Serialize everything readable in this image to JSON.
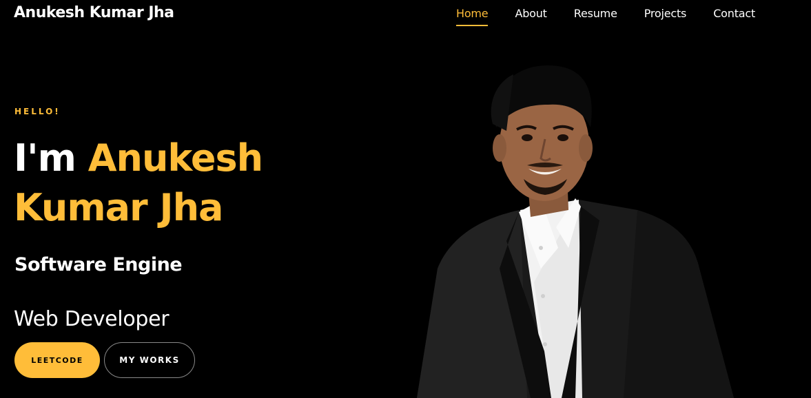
{
  "header": {
    "brand": "Anukesh Kumar Jha",
    "nav": [
      {
        "label": "Home",
        "active": true
      },
      {
        "label": "About",
        "active": false
      },
      {
        "label": "Resume",
        "active": false
      },
      {
        "label": "Projects",
        "active": false
      },
      {
        "label": "Contact",
        "active": false
      }
    ]
  },
  "hero": {
    "greeting": "HELLO!",
    "intro": "I'm ",
    "name_line1": "Anukesh",
    "name_line2": "Kumar Jha",
    "role": "Software Engine",
    "subrole": "Web Developer",
    "buttons": {
      "primary": "LEETCODE",
      "secondary": "MY WORKS"
    }
  },
  "colors": {
    "background": "#000000",
    "accent": "#ffbd39",
    "text": "#ffffff"
  }
}
